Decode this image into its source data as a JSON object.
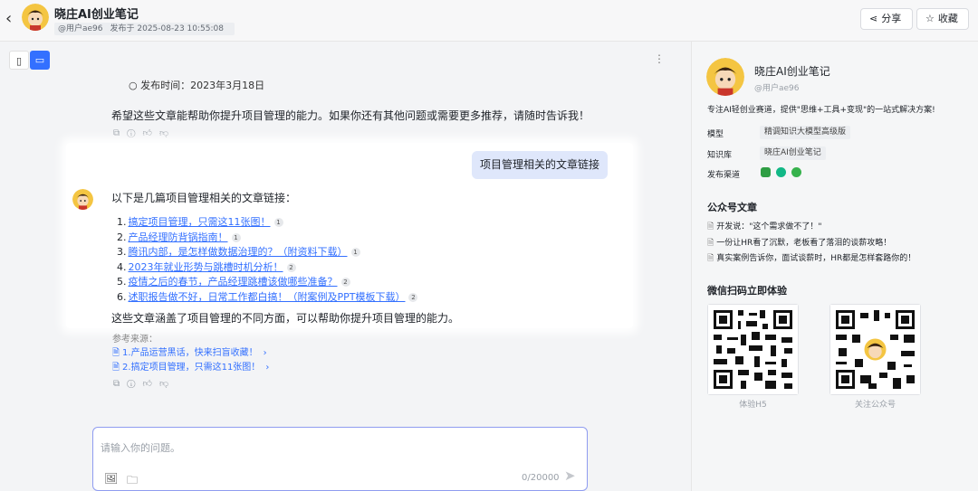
{
  "header": {
    "title": "晓庄AI创业笔记",
    "user": "@用户ae96",
    "published": "发布于 2025-08-23 10:55:08",
    "share_label": "分享",
    "favorite_label": "收藏"
  },
  "chat": {
    "prev_publish_time": "发布时间：2023年3月18日",
    "prev_closing": "希望这些文章能帮助你提升项目管理的能力。如果你还有其他问题或需要更多推荐，请随时告诉我！",
    "user_question": "项目管理相关的文章链接",
    "answer_intro": "以下是几篇项目管理相关的文章链接：",
    "links": [
      {
        "num": "1.",
        "title": "搞定项目管理，只需这11张图！",
        "cite": "1"
      },
      {
        "num": "2.",
        "title": "产品经理防背锅指南！",
        "cite": "1"
      },
      {
        "num": "3.",
        "title": "腾讯内部，是怎样做数据治理的？（附资料下载）",
        "cite": "1"
      },
      {
        "num": "4.",
        "title": "2023年就业形势与跳槽时机分析！",
        "cite": "2"
      },
      {
        "num": "5.",
        "title": "疫情之后的春节，产品经理跳槽该做哪些准备？",
        "cite": "2"
      },
      {
        "num": "6.",
        "title": "述职报告做不好，日常工作都白搞！（附案例及PPT模板下载）",
        "cite": "2"
      }
    ],
    "answer_outro": "这些文章涵盖了项目管理的不同方面，可以帮助你提升项目管理的能力。",
    "ref_label": "参考来源：",
    "refs": [
      "1.产品运营黑话，快来扫盲收藏！",
      "2.搞定项目管理，只需这11张图！"
    ]
  },
  "input": {
    "placeholder": "请输入你的问题。",
    "counter": "0/20000"
  },
  "panel": {
    "name": "晓庄AI创业笔记",
    "user": "@用户ae96",
    "description": "专注AI轻创业赛道，提供\"思维+工具+变现\"的一站式解决方案!",
    "model_label": "模型",
    "model_value": "精调知识大模型高级版",
    "kb_label": "知识库",
    "kb_value": "晓庄AI创业笔记",
    "channel_label": "发布渠道",
    "articles_title": "公众号文章",
    "articles": [
      "开发说：\"这个需求做不了！\"",
      "一份让HR看了沉默，老板看了落泪的谈薪攻略！",
      "真实案例告诉你，面试谈薪时，HR都是怎样套路你的！"
    ],
    "qr_title": "微信扫码立即体验",
    "qr_h5_label": "体验H5",
    "qr_mp_label": "关注公众号"
  },
  "colors": {
    "accent": "#3370ff",
    "bubble": "#dfe7fb"
  }
}
